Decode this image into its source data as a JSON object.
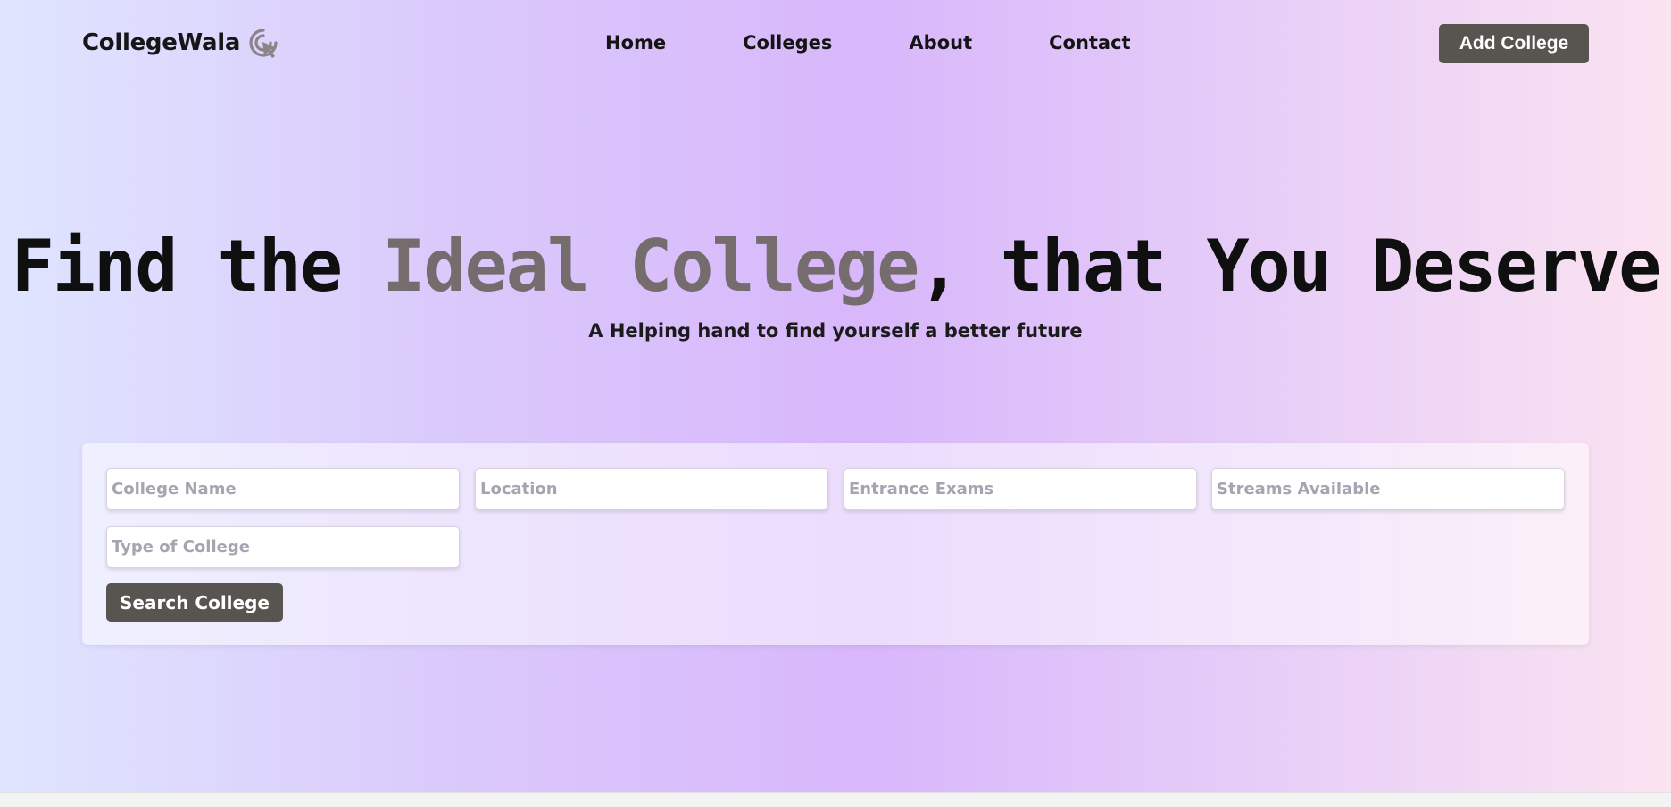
{
  "nav": {
    "logo_text": "CollegeWala",
    "logo_icon": "cursor-click-icon",
    "links": [
      "Home",
      "Colleges",
      "About",
      "Contact"
    ],
    "add_button": "Add College"
  },
  "hero": {
    "title_before": "Find the ",
    "title_highlight": "Ideal College",
    "title_after": ", that You Deserve",
    "subtitle": "A Helping hand to find yourself a better future"
  },
  "search": {
    "fields": [
      {
        "placeholder": "College Name",
        "value": ""
      },
      {
        "placeholder": "Location",
        "value": ""
      },
      {
        "placeholder": "Entrance Exams",
        "value": ""
      },
      {
        "placeholder": "Streams Available",
        "value": ""
      },
      {
        "placeholder": "Type of College",
        "value": ""
      }
    ],
    "button": "Search College"
  },
  "colors": {
    "button_bg": "#585450",
    "highlight": "#756c6e",
    "gradient": [
      "#dfe5ff",
      "#d8b7fb",
      "#fbe3f1"
    ]
  }
}
